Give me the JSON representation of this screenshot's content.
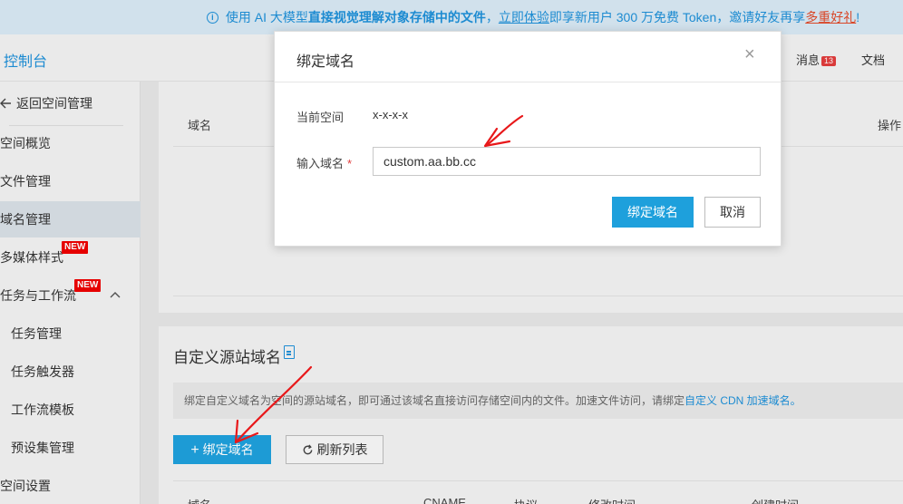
{
  "banner": {
    "text_pre": "使用 AI 大模型",
    "text_bold": "直接视觉理解对象存储中的文件",
    "text_mid": "，",
    "link": "立即体验",
    "text_post": "即享新用户 300 万免费 Token，邀请好友再享",
    "brand_link": "多重好礼",
    "text_end": "!"
  },
  "topbar": {
    "console": "控制台",
    "messages": "消息",
    "message_count": "13",
    "docs": "文档"
  },
  "sidebar": {
    "back": "返回空间管理",
    "items": [
      "空间概览",
      "文件管理",
      "域名管理",
      "多媒体样式",
      "任务与工作流",
      "任务管理",
      "任务触发器",
      "工作流模板",
      "预设集管理",
      "空间设置"
    ],
    "new_badge": "NEW"
  },
  "table1": {
    "col_domain": "域名",
    "col_action": "操作"
  },
  "section2": {
    "title": "自定义源站域名",
    "note_text": "绑定自定义域名为空间的源站域名，即可通过该域名直接访问存储空间内的文件。加速文件访问，请绑定",
    "note_link": "自定义 CDN 加速域名。",
    "bind_button": "绑定域名",
    "refresh_button": "刷新列表",
    "cols": [
      "域名",
      "CNAME",
      "协议",
      "修改时间",
      "创建时间"
    ]
  },
  "modal": {
    "title": "绑定域名",
    "current_space_label": "当前空间",
    "current_space_value": "x-x-x-x",
    "domain_label": "输入域名",
    "required_mark": "*",
    "domain_value": "custom.aa.bb.cc",
    "ok_button": "绑定域名",
    "cancel_button": "取消"
  },
  "colors": {
    "accent": "#1ea0dc",
    "annotation": "#e8181a",
    "badge": "#e00000"
  }
}
